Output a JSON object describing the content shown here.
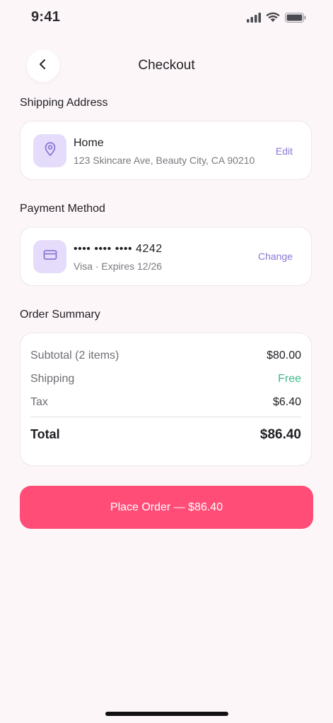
{
  "status_bar": {
    "time": "9:41",
    "icons": [
      "signal-icon",
      "wifi-icon",
      "battery-icon"
    ]
  },
  "header": {
    "back_icon": "chevron-left-icon",
    "title": "Checkout"
  },
  "shipping": {
    "section_title": "Shipping Address",
    "icon": "location-pin-icon",
    "name": "Home",
    "address": "123 Skincare Ave, Beauty City, CA 90210",
    "action_label": "Edit"
  },
  "payment": {
    "section_title": "Payment Method",
    "icon": "credit-card-icon",
    "card_number": "•••• •••• •••• 4242",
    "card_details": "Visa · Expires 12/26",
    "action_label": "Change"
  },
  "summary": {
    "section_title": "Order Summary",
    "rows": [
      {
        "label": "Subtotal (2 items)",
        "value": "$80.00"
      },
      {
        "label": "Shipping",
        "value": "Free"
      },
      {
        "label": "Tax",
        "value": "$6.40"
      }
    ],
    "total_label": "Total",
    "total_value": "$86.40"
  },
  "place_order": {
    "label": "Place Order — $86.40"
  },
  "colors": {
    "background": "#fdf6f9",
    "accent_pink": "#ff4d77",
    "accent_purple": "#8c76d6",
    "icon_tile": "#e5dcfb",
    "free_green": "#3fb98a"
  }
}
